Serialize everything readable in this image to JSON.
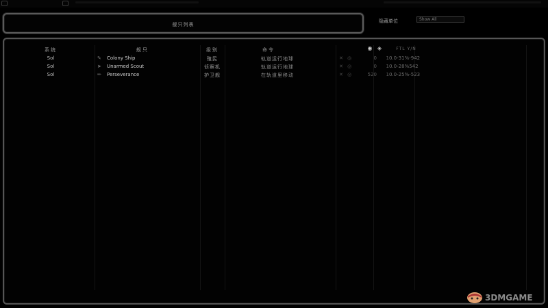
{
  "header_panel": {
    "title": "舰只列表"
  },
  "filter": {
    "label": "隐藏单位",
    "selected": "Show All"
  },
  "columns": {
    "system": "系统",
    "ship": "舰只",
    "class": "级别",
    "order": "命令",
    "fuel_icon": "fuel-icon",
    "damage_icon": "damage-icon",
    "location": "FTL Y/N"
  },
  "rows": [
    {
      "system": "Sol",
      "ship_icon": "wrench-icon",
      "ship": "Colony Ship",
      "class": "殖民",
      "order": "轨道运行地球",
      "fuel": "0",
      "damage": "1",
      "location": "0.0-31%-942"
    },
    {
      "system": "Sol",
      "ship_icon": "scout-icon",
      "ship": "Unarmed Scout",
      "class": "侦察机",
      "order": "轨道运行地球",
      "fuel": "0",
      "damage": "1",
      "location": "0.0-28%542"
    },
    {
      "system": "Sol",
      "ship_icon": "pencil-icon",
      "ship": "Perseverance",
      "class": "护卫舰",
      "order": "在轨道里移动",
      "fuel": "520",
      "damage": "1",
      "location": "0.0-25%-523"
    }
  ],
  "watermark": {
    "text": "3DMGAME"
  },
  "colors": {
    "frame": "#555555",
    "text": "#a8a8a8",
    "background": "#000000"
  }
}
